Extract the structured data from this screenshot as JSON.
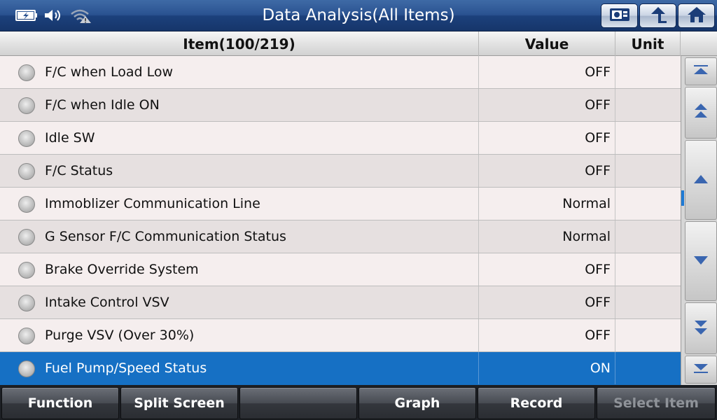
{
  "window": {
    "title": "Data Analysis(All Items)",
    "status_icons": [
      "battery-charging-icon",
      "speaker-icon",
      "wifi-warning-icon"
    ],
    "top_buttons": [
      "screenshot-icon",
      "back-arrow-icon",
      "home-icon"
    ]
  },
  "table": {
    "headers": {
      "item": "Item(100/219)",
      "value": "Value",
      "unit": "Unit"
    },
    "rows": [
      {
        "item": "F/C when Load Low",
        "value": "OFF",
        "unit": ""
      },
      {
        "item": "F/C when Idle ON",
        "value": "OFF",
        "unit": ""
      },
      {
        "item": "Idle SW",
        "value": "OFF",
        "unit": ""
      },
      {
        "item": "F/C Status",
        "value": "OFF",
        "unit": ""
      },
      {
        "item": "Immoblizer Communication Line",
        "value": "Normal",
        "unit": ""
      },
      {
        "item": "G Sensor F/C Communication Status",
        "value": "Normal",
        "unit": ""
      },
      {
        "item": "Brake Override System",
        "value": "OFF",
        "unit": ""
      },
      {
        "item": "Intake Control VSV",
        "value": "OFF",
        "unit": ""
      },
      {
        "item": "Purge VSV (Over 30%)",
        "value": "OFF",
        "unit": ""
      },
      {
        "item": "Fuel Pump/Speed Status",
        "value": "ON",
        "unit": ""
      }
    ],
    "selected_index": 9
  },
  "scrollbar": {
    "buttons": [
      "scroll-top-icon",
      "page-up-icon",
      "line-up-icon",
      "line-down-icon",
      "page-down-icon",
      "scroll-bottom-icon"
    ]
  },
  "toolbar": {
    "function": "Function",
    "split_screen": "Split Screen",
    "blank": "",
    "graph": "Graph",
    "record": "Record",
    "select_item": "Select Item"
  },
  "colors": {
    "title_bar": "#2a5290",
    "selected_row": "#1670c4",
    "row_light": "#f5eeee",
    "row_dark": "#e6e0e0",
    "toolbar": "#3a3d43"
  }
}
